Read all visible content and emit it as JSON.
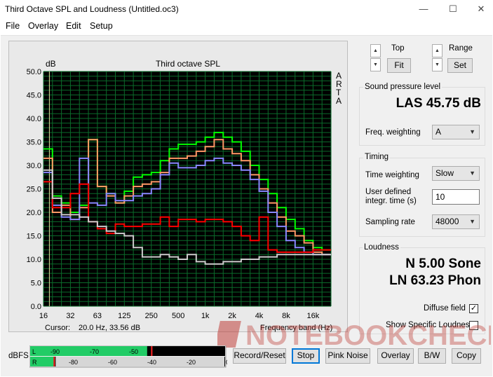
{
  "window": {
    "title": "Third Octave SPL and Loudness (Untitled.oc3)",
    "minimize_glyph": "—",
    "maximize_glyph": "☐",
    "close_glyph": "✕"
  },
  "menu": [
    "File",
    "Overlay",
    "Edit",
    "Setup"
  ],
  "plot": {
    "unit_label": "dB",
    "cursor_label": "Cursor:",
    "cursor_value": "20.0 Hz, 33.56 dB",
    "right_letters": [
      "A",
      "R",
      "T",
      "A"
    ]
  },
  "chart_data": {
    "type": "line",
    "title": "Third octave SPL",
    "ylabel": "dB",
    "xlabel": "Frequency band (Hz)",
    "ylim": [
      0,
      50
    ],
    "yticks": [
      "0.0",
      "5.0",
      "10.0",
      "15.0",
      "20.0",
      "25.0",
      "30.0",
      "35.0",
      "40.0",
      "45.0",
      "50.0"
    ],
    "xtick_labels": [
      "16",
      "32",
      "63",
      "125",
      "250",
      "500",
      "1k",
      "2k",
      "4k",
      "8k",
      "16k"
    ],
    "bands": [
      "16",
      "20",
      "25",
      "31.5",
      "40",
      "50",
      "63",
      "80",
      "100",
      "125",
      "160",
      "200",
      "250",
      "315",
      "400",
      "500",
      "630",
      "800",
      "1k",
      "1.25k",
      "1.6k",
      "2k",
      "2.5k",
      "3.15k",
      "4k",
      "5k",
      "6.3k",
      "8k",
      "10k",
      "12.5k",
      "16k",
      "20k"
    ],
    "grid": true,
    "background": "#000000",
    "series": [
      {
        "color": "#00ff00",
        "values": [
          33.5,
          23.5,
          22.0,
          20.0,
          21.5,
          35.5,
          25.5,
          24.0,
          22.0,
          24.5,
          27.5,
          28.0,
          28.5,
          31.0,
          33.5,
          34.5,
          34.5,
          35.0,
          36.0,
          37.0,
          36.0,
          35.0,
          33.0,
          30.0,
          27.0,
          24.0,
          21.0,
          18.5,
          16.5,
          14.0,
          12.5,
          12.0
        ]
      },
      {
        "color": "#ff9966",
        "values": [
          31.5,
          20.0,
          21.5,
          18.5,
          21.0,
          35.5,
          25.5,
          23.5,
          22.0,
          23.5,
          25.5,
          26.0,
          26.5,
          28.5,
          31.5,
          31.5,
          32.0,
          33.0,
          34.0,
          35.5,
          33.5,
          32.5,
          31.0,
          28.0,
          25.0,
          22.0,
          19.0,
          16.0,
          15.0,
          13.5,
          11.5,
          11.0
        ]
      },
      {
        "color": "#8888ff",
        "values": [
          28.5,
          21.5,
          19.0,
          18.5,
          31.5,
          22.0,
          21.5,
          24.0,
          22.5,
          22.5,
          23.5,
          24.0,
          25.0,
          28.0,
          30.5,
          29.5,
          29.5,
          30.0,
          31.0,
          31.5,
          30.5,
          30.0,
          29.0,
          27.0,
          24.5,
          20.0,
          17.0,
          14.0,
          12.5,
          11.5,
          11.0,
          11.0
        ]
      },
      {
        "color": "#ff0000",
        "values": [
          26.5,
          21.0,
          21.0,
          24.0,
          26.0,
          18.0,
          16.5,
          15.5,
          17.5,
          17.0,
          17.0,
          17.5,
          17.5,
          19.0,
          17.0,
          18.5,
          18.5,
          18.0,
          18.5,
          18.5,
          18.0,
          17.0,
          15.0,
          14.0,
          19.0,
          12.0,
          11.5,
          11.5,
          11.5,
          11.5,
          12.0,
          12.0
        ]
      },
      {
        "color": "#cccccc",
        "values": [
          29.0,
          23.0,
          19.5,
          19.5,
          19.0,
          18.0,
          17.0,
          16.0,
          15.5,
          15.0,
          12.5,
          10.5,
          10.5,
          11.0,
          10.5,
          10.0,
          11.0,
          9.5,
          9.0,
          9.0,
          9.5,
          9.5,
          10.0,
          10.0,
          10.5,
          10.5,
          11.0,
          11.0,
          11.0,
          11.0,
          11.0,
          11.0
        ]
      }
    ]
  },
  "controls": {
    "top_label": "Top",
    "fit_label": "Fit",
    "range_label": "Range",
    "set_label": "Set",
    "up_glyph": "▲",
    "down_glyph": "▼"
  },
  "spl": {
    "group_label": "Sound pressure level",
    "reading": "LAS 45.75 dB",
    "freq_weighting_label": "Freq. weighting",
    "freq_weighting_value": "A"
  },
  "timing": {
    "group_label": "Timing",
    "time_weighting_label": "Time weighting",
    "time_weighting_value": "Slow",
    "integr_label_1": "User defined",
    "integr_label_2": "integr. time (s)",
    "integr_value": "10",
    "sampling_label": "Sampling rate",
    "sampling_value": "48000"
  },
  "loudness": {
    "group_label": "Loudness",
    "sone": "N 5.00 Sone",
    "phon": "LN 63.23 Phon",
    "diffuse_label": "Diffuse field",
    "diffuse_checked": "✓",
    "specific_label": "Show Specific Loudness"
  },
  "meter": {
    "label": "dBFS",
    "l_channel": "L",
    "r_channel": "R",
    "top_ticks": [
      "-90",
      "-70",
      "-50",
      "-30",
      "-10"
    ],
    "bottom_ticks": [
      "-80",
      "-60",
      "-40",
      "-20",
      "0"
    ],
    "l_level": 0.6,
    "r_level": 0.12,
    "l_peak": 0.62
  },
  "buttons": {
    "record_reset": "Record/Reset",
    "stop": "Stop",
    "pink_noise": "Pink Noise",
    "overlay": "Overlay",
    "bw": "B/W",
    "copy": "Copy"
  },
  "watermark": "NOTEBOOKCHECK"
}
